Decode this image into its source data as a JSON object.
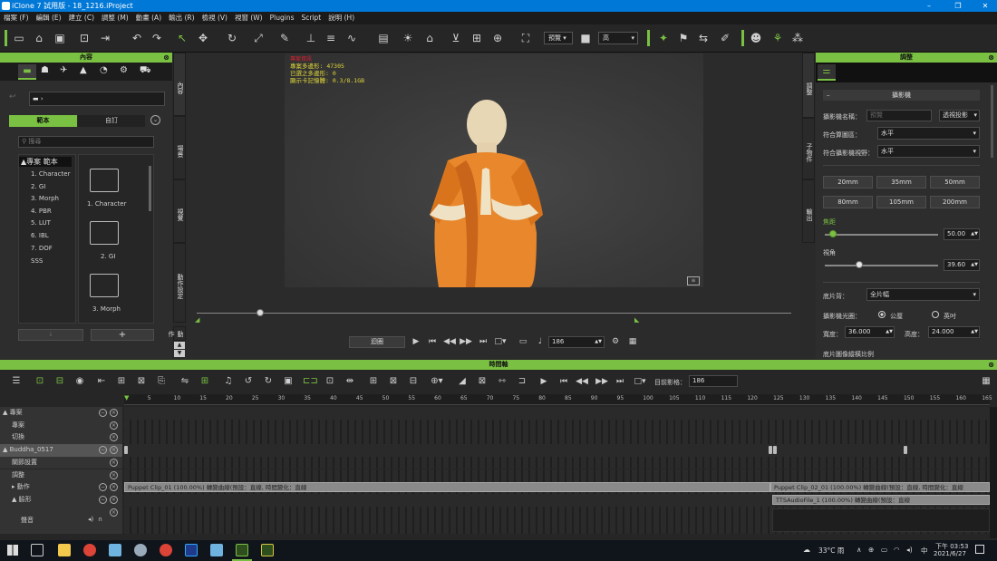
{
  "window": {
    "title": "iClone 7 試用版 - 18_1216.iProject",
    "min": "–",
    "max": "❐",
    "close": "✕"
  },
  "menu": [
    "檔案 (F)",
    "編輯 (E)",
    "建立 (C)",
    "調整 (M)",
    "動畫 (A)",
    "輸出 (R)",
    "檢視 (V)",
    "視窗 (W)",
    "Plugins",
    "Script",
    "說明 (H)"
  ],
  "toolbar": {
    "preview_select": "預覽",
    "quality_select": "高"
  },
  "content_panel": {
    "title": "內容",
    "tab_template": "範本",
    "tab_custom": "自訂",
    "search_placeholder": "搜尋",
    "tree_root": "▲專案 範本",
    "tree_items": [
      "1. Character",
      "2. GI",
      "3. Morph",
      "4. PBR",
      "5. LUT",
      "6. IBL",
      "7. DOF",
      "SSS"
    ],
    "folders": [
      "1. Character",
      "2. GI",
      "3. Morph"
    ],
    "add": "+"
  },
  "side_tabs_left": [
    "內容",
    "場景",
    "視覺",
    "動作設定",
    "動作"
  ],
  "viewport": {
    "stats_title": "專案資訊",
    "stats": [
      "專案多邊形: 47305",
      "已選之多邊形: 0",
      "顯示卡記憶體: 0.3/8.1GB"
    ]
  },
  "playback": {
    "loop": "迴圈",
    "frame": "186"
  },
  "modify_panel": {
    "title": "調整",
    "section": "攝影機",
    "camera_name_label": "攝影機名稱：",
    "camera_name_value": "預覽",
    "projection": "透視投影",
    "fit_gate_label": "符合算圖區：",
    "fit_gate_value": "水平",
    "fit_film_label": "符合攝影機視野：",
    "fit_film_value": "水平",
    "lens_buttons": [
      "20mm",
      "35mm",
      "50mm",
      "80mm",
      "105mm",
      "200mm"
    ],
    "focal_label": "焦距",
    "focal_value": "50.00",
    "focal_fraction": 0.07,
    "fov_label": "視角",
    "fov_value": "39.60",
    "fov_fraction": 0.3,
    "film_label": "底片背：",
    "film_value": "全片幅",
    "aperture_label": "攝影機光圈：",
    "unit_mm": "公厘",
    "unit_inch": "英吋",
    "width_label": "寬度：",
    "width_value": "36.000",
    "height_label": "高度：",
    "height_value": "24.000",
    "ratio_label": "底片圖像縱橫比例"
  },
  "side_tabs_right": [
    "調整",
    "子物件",
    "輸出"
  ],
  "timeline": {
    "title": "時間軸",
    "current_frame_label": "目前影格：",
    "current_frame": "186",
    "ruler": [
      "5",
      "10",
      "15",
      "20",
      "25",
      "30",
      "35",
      "40",
      "45",
      "50",
      "55",
      "60",
      "65",
      "70",
      "75",
      "80",
      "85",
      "90",
      "95",
      "100",
      "105",
      "110",
      "115",
      "120",
      "125",
      "130",
      "135",
      "140",
      "145",
      "150",
      "155",
      "160",
      "165"
    ],
    "tracks": [
      {
        "name": "▲ 專案",
        "indent": 0
      },
      {
        "name": "專案",
        "indent": 1
      },
      {
        "name": "切換",
        "indent": 1
      },
      {
        "name": "▲ Buddha_0517",
        "indent": 0,
        "selected": true
      },
      {
        "name": "關節設置",
        "indent": 1
      },
      {
        "name": "調整",
        "indent": 1
      },
      {
        "name": "▸ 動作",
        "indent": 1
      },
      {
        "name": "▲ 臉形",
        "indent": 1
      },
      {
        "name": "聲音",
        "indent": 2
      }
    ],
    "clip1": "Puppet Clip_01 (100.00%) 轉變曲線(預設：直線, 時間變化：直線",
    "clip2": "Puppet Clip_02_01 (100.00%) 轉變曲線(預設：直線, 時間變化：直線",
    "clip3": "TTSAudioFile_1 (100.00%) 轉變曲線(預設：直線"
  },
  "taskbar": {
    "weather": "33°C 雨",
    "lang": "中",
    "time": "下午 03:53",
    "date": "2021/6/27"
  }
}
